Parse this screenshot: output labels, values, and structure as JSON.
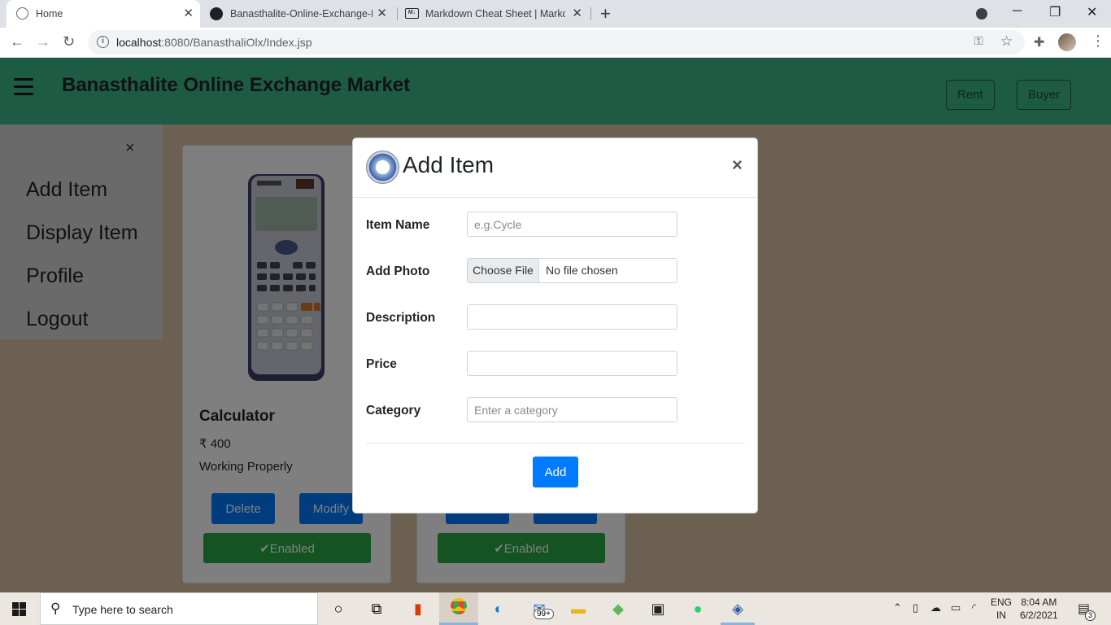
{
  "browser": {
    "tabs": [
      {
        "title": "Home",
        "active": true,
        "icon": "globe-icon"
      },
      {
        "title": "Banasthalite-Online-Exchange-M",
        "active": false,
        "icon": "github-icon"
      },
      {
        "title": "Markdown Cheat Sheet | Markdo",
        "active": false,
        "icon": "markdown-icon"
      }
    ],
    "url_host": "localhost",
    "url_path": ":8080/BanasthaliOlx/Index.jsp"
  },
  "navbar": {
    "brand": "Banasthalite Online Exchange Market",
    "rent_label": "Rent",
    "buyer_label": "Buyer",
    "accent": "#3cb68a"
  },
  "sidenav": {
    "close": "×",
    "items": [
      "Add Item",
      "Display Item",
      "Profile",
      "Logout"
    ]
  },
  "cards": [
    {
      "title": "Calculator",
      "price": "₹ 400",
      "description": "Working Properly",
      "delete_label": "Delete",
      "modify_label": "Modify",
      "status_label": "✔Enabled"
    },
    {
      "title": "",
      "price": "",
      "description": "",
      "delete_label": "",
      "modify_label": "",
      "status_label": "✔Enabled"
    }
  ],
  "modal": {
    "title": "Add Item",
    "close": "×",
    "fields": {
      "item_name_label": "Item Name",
      "item_name_placeholder": "e.g.Cycle",
      "photo_label": "Add Photo",
      "choose_file": "Choose File",
      "no_file": "No file chosen",
      "description_label": "Description",
      "price_label": "Price",
      "category_label": "Category",
      "category_placeholder": "Enter a category"
    },
    "add_label": "Add"
  },
  "taskbar": {
    "search_placeholder": "Type here to search",
    "mail_badge": "99+",
    "lang_top": "ENG",
    "lang_bottom": "IN",
    "time": "8:04 AM",
    "date": "6/2/2021",
    "notification_count": "3"
  }
}
